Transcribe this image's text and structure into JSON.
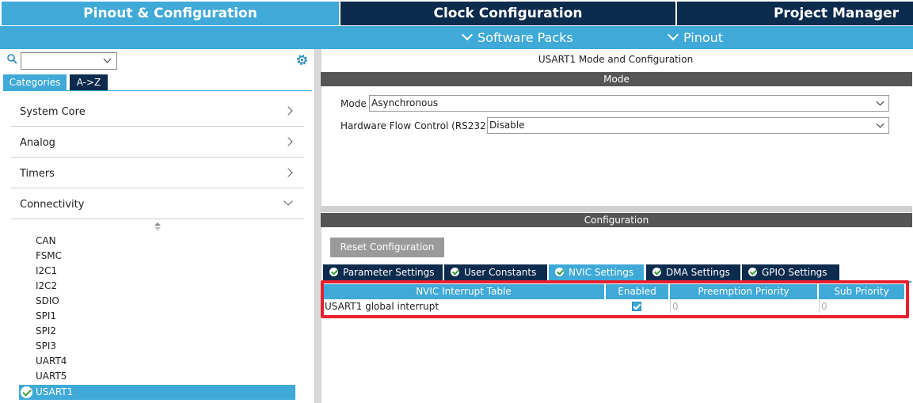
{
  "top_tabs": {
    "pinout": "Pinout & Configuration",
    "clock": "Clock Configuration",
    "project": "Project Manager"
  },
  "sub_menu": {
    "software_packs": "Software Packs",
    "pinout": "Pinout"
  },
  "left": {
    "search": {
      "value": ""
    },
    "tabs": {
      "categories": "Categories",
      "az": "A->Z"
    },
    "categories": [
      {
        "label": "System Core"
      },
      {
        "label": "Analog"
      },
      {
        "label": "Timers"
      },
      {
        "label": "Connectivity"
      }
    ],
    "connectivity_items": [
      "CAN",
      "FSMC",
      "I2C1",
      "I2C2",
      "SDIO",
      "SPI1",
      "SPI2",
      "SPI3",
      "UART4",
      "UART5"
    ],
    "selected_item": "USART1"
  },
  "right": {
    "title": "USART1 Mode and Configuration",
    "mode_header": "Mode",
    "mode_label": "Mode",
    "mode_value": "Asynchronous",
    "hwflow_label": "Hardware Flow Control (RS232)",
    "hwflow_value": "Disable",
    "config_header": "Configuration",
    "reset_button": "Reset Configuration",
    "config_tabs": [
      "Parameter Settings",
      "User Constants",
      "NVIC Settings",
      "DMA Settings",
      "GPIO Settings"
    ],
    "active_tab": "NVIC Settings",
    "nvic": {
      "headers": [
        "NVIC Interrupt Table",
        "Enabled",
        "Preemption Priority",
        "Sub Priority"
      ],
      "rows": [
        {
          "name": "USART1 global interrupt",
          "enabled": true,
          "preemption": "0",
          "sub": "0"
        }
      ]
    }
  },
  "colors": {
    "accent": "#3fa9d8",
    "dark_navy": "#0d2b4d",
    "section_bar": "#555555",
    "highlight": "#e8202e"
  }
}
